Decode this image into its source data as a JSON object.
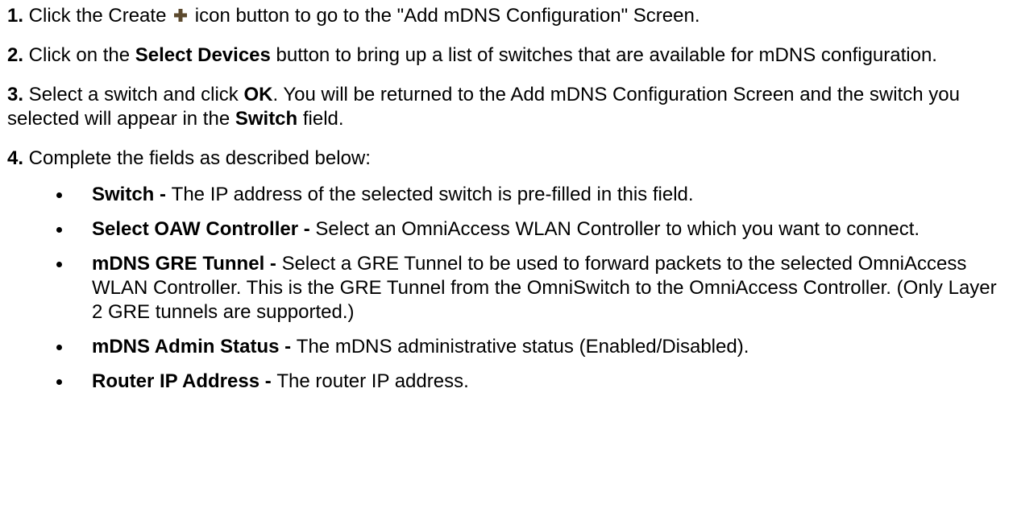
{
  "steps": [
    {
      "num": "1.",
      "pre": " Click the Create ",
      "icon": "plus-icon",
      "post": " icon button to go to the \"Add mDNS Configuration\" Screen."
    },
    {
      "num": "2.",
      "t1": " Click on the ",
      "b1": "Select Devices",
      "t2": " button to bring up a list of switches that are available for mDNS configuration."
    },
    {
      "num": "3.",
      "t1": " Select a switch and click ",
      "b1": "OK",
      "t2": ". You will be returned to the Add mDNS Configuration Screen and the switch you selected will appear in the ",
      "b2": "Switch",
      "t3": " field."
    },
    {
      "num": "4.",
      "t1": " Complete the fields as described below:"
    }
  ],
  "fields": [
    {
      "term": "Switch - ",
      "desc": "The IP address of the selected switch is pre-filled in this field."
    },
    {
      "term": "Select OAW Controller - ",
      "desc": "Select an OmniAccess WLAN Controller to which you want to connect."
    },
    {
      "term": "mDNS GRE Tunnel - ",
      "desc": "Select a GRE Tunnel to be used to forward packets to the selected OmniAccess WLAN Controller. This is the GRE Tunnel from the OmniSwitch to the OmniAccess Controller. (Only Layer 2 GRE tunnels are supported.)"
    },
    {
      "term": "mDNS Admin Status - ",
      "desc": "The mDNS administrative status (Enabled/Disabled)."
    },
    {
      "term": "Router IP Address - ",
      "desc": "The router IP address."
    }
  ],
  "colors": {
    "text": "#000000",
    "background": "#ffffff"
  }
}
